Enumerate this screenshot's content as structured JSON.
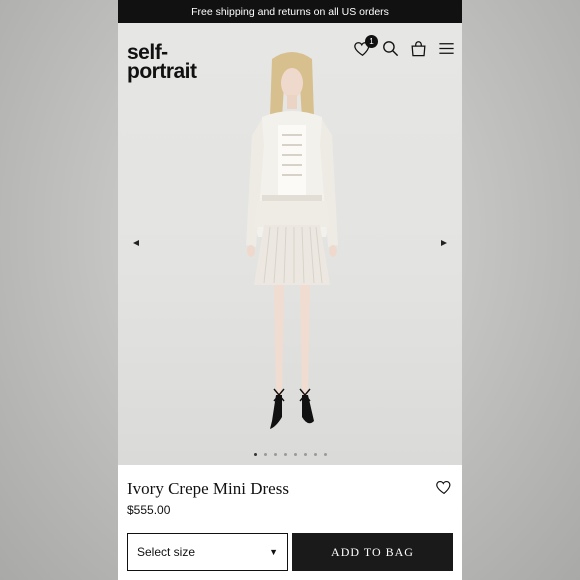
{
  "promo_bar": {
    "text": "Free shipping and returns on all US orders"
  },
  "header": {
    "logo_line1": "self-",
    "logo_line2": "portrait",
    "wishlist_count": "1",
    "icons": [
      "heart-icon",
      "search-icon",
      "bag-icon",
      "menu-icon"
    ]
  },
  "gallery": {
    "slide_count": 8,
    "active_index": 0,
    "prev_icon": "arrow-left-icon",
    "next_icon": "arrow-right-icon"
  },
  "product": {
    "title": "Ivory Crepe Mini Dress",
    "price": "$555.00",
    "size_select": "Select size",
    "add_to_bag": "ADD TO BAG"
  },
  "colors": {
    "dark": "#111111",
    "hero_bg": "#e4e4e2",
    "white": "#ffffff"
  }
}
